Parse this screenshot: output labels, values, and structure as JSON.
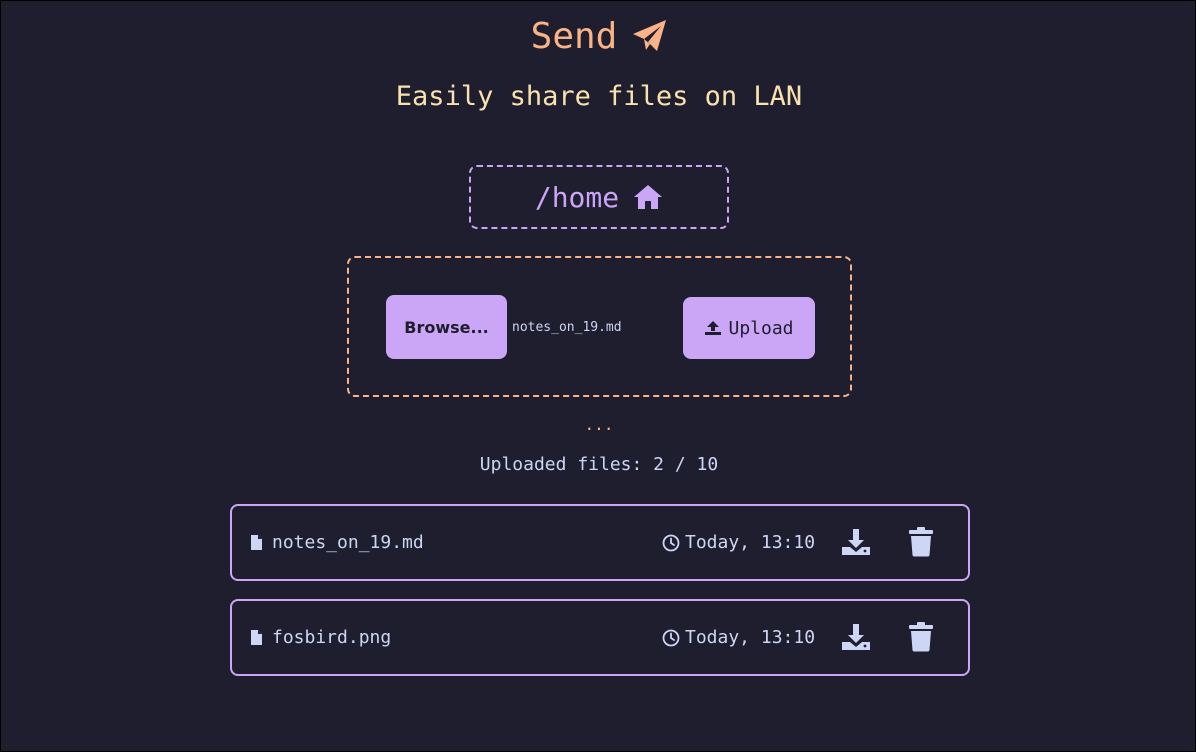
{
  "header": {
    "title": "Send",
    "title_icon": "paper-plane-icon",
    "subtitle": "Easily share files on LAN"
  },
  "path": {
    "current": "/home",
    "icon": "home-icon"
  },
  "uploader": {
    "browse_label": "Browse...",
    "selected_file": "notes_on_19.md",
    "upload_label": "Upload",
    "upload_icon": "upload-icon"
  },
  "status": {
    "progress": "...",
    "uploaded_count": "Uploaded files: 2 / 10"
  },
  "files": [
    {
      "name": "notes_on_19.md",
      "time": "Today, 13:10"
    },
    {
      "name": "fosbird.png",
      "time": "Today, 13:10"
    }
  ],
  "colors": {
    "background": "#1e1e2e",
    "accent_purple": "#cba6f7",
    "accent_peach": "#fab387",
    "accent_yellow": "#f9e2af",
    "text": "#cdd6f4"
  }
}
